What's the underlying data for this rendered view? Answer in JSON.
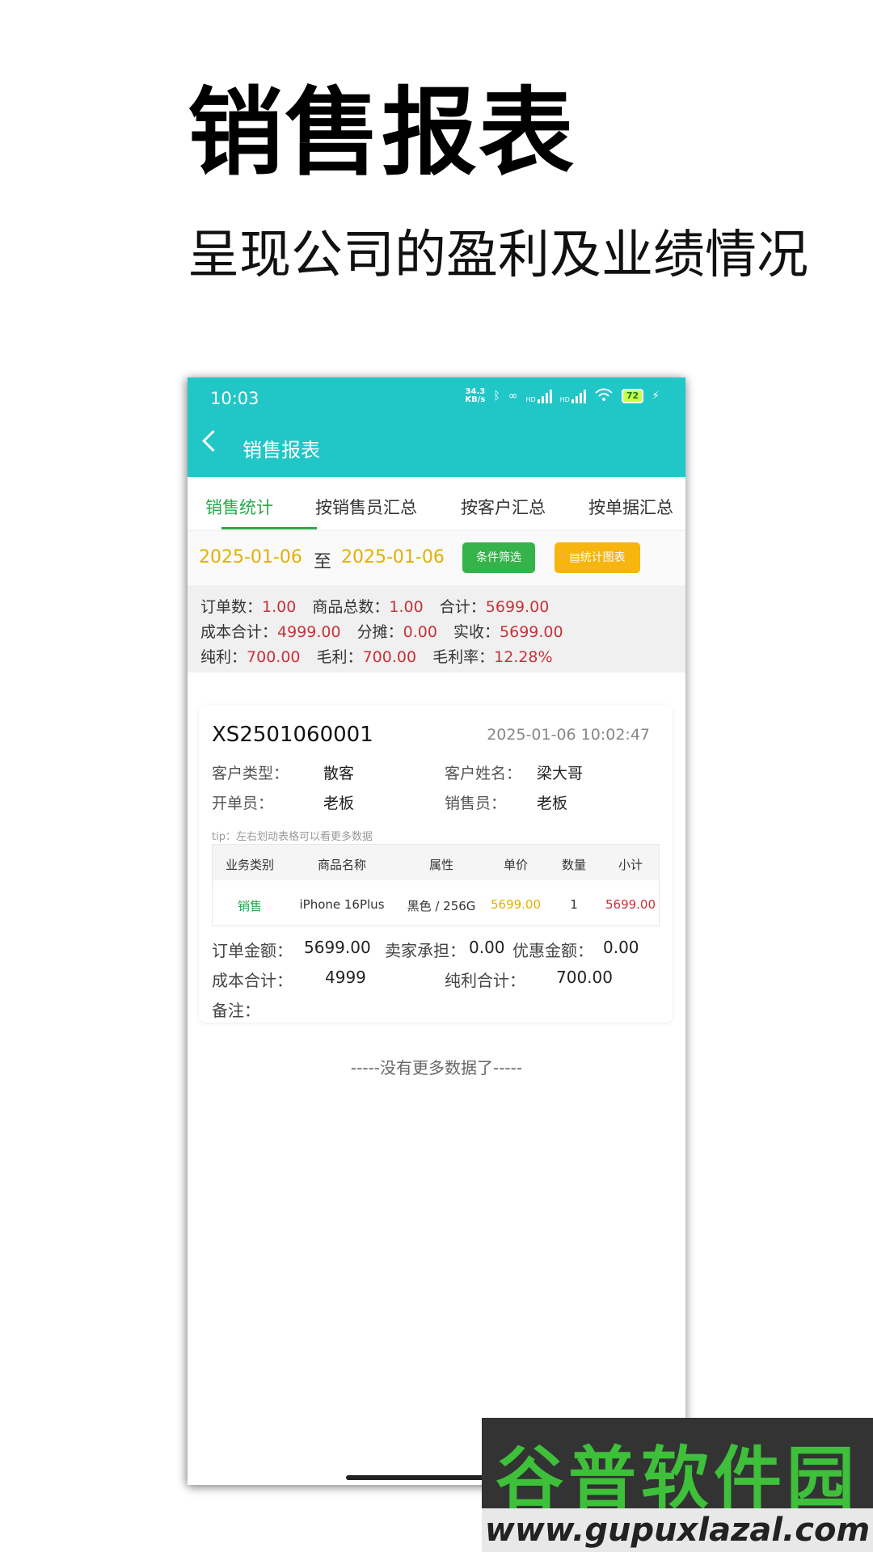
{
  "hero": {
    "title": "销售报表",
    "subtitle": "呈现公司的盈利及业绩情况"
  },
  "status_bar": {
    "time": "10:03",
    "speed_top": "34.3",
    "speed_bottom": "KB/s",
    "hd1": "HD",
    "hd2": "HD",
    "battery": "72"
  },
  "nav": {
    "title": "销售报表"
  },
  "tabs": [
    {
      "label": "销售统计",
      "active": true
    },
    {
      "label": "按销售员汇总"
    },
    {
      "label": "按客户汇总"
    },
    {
      "label": "按单据汇总"
    }
  ],
  "filter": {
    "start_date": "2025-01-06",
    "separator": "至",
    "end_date": "2025-01-06",
    "filter_button": "条件筛选",
    "chart_button": "统计图表"
  },
  "summary": {
    "order_count_label": "订单数：",
    "order_count": "1.00",
    "goods_total_label": "商品总数：",
    "goods_total": "1.00",
    "total_label": "合计：",
    "total": "5699.00",
    "cost_total_label": "成本合计：",
    "cost_total": "4999.00",
    "share_label": "分摊：",
    "share": "0.00",
    "received_label": "实收：",
    "received": "5699.00",
    "net_profit_label": "纯利：",
    "net_profit": "700.00",
    "gross_profit_label": "毛利：",
    "gross_profit": "700.00",
    "gross_margin_label": "毛利率：",
    "gross_margin": "12.28%"
  },
  "order": {
    "order_no": "XS2501060001",
    "datetime": "2025-01-06 10:02:47",
    "customer_type_label": "客户类型：",
    "customer_type": "散客",
    "customer_name_label": "客户姓名：",
    "customer_name": "梁大哥",
    "creator_label": "开单员：",
    "creator": "老板",
    "seller_label": "销售员：",
    "seller": "老板",
    "tip": "tip：左右划动表格可以看更多数据",
    "table": {
      "headers": [
        "业务类别",
        "商品名称",
        "属性",
        "单价",
        "数量",
        "小计"
      ],
      "rows": [
        [
          "销售",
          "iPhone 16Plus",
          "黑色 / 256G",
          "5699.00",
          "1",
          "5699.00"
        ]
      ]
    },
    "order_amount_label": "订单金额：",
    "order_amount": "5699.00",
    "seller_bear_label": "卖家承担：",
    "seller_bear": "0.00",
    "discount_label": "优惠金额：",
    "discount": "0.00",
    "cost_label": "成本合计：",
    "cost": "4999",
    "profit_label": "纯利合计：",
    "profit": "700.00",
    "remark_label": "备注："
  },
  "no_more": "-----没有更多数据了-----",
  "watermark": {
    "top": "谷普软件园",
    "bottom": "www.gupuxlazal.com"
  },
  "colors": {
    "accent": "#21c6c7",
    "green": "#2aa84a",
    "yellow": "#e2b100",
    "red": "#c8323a"
  }
}
